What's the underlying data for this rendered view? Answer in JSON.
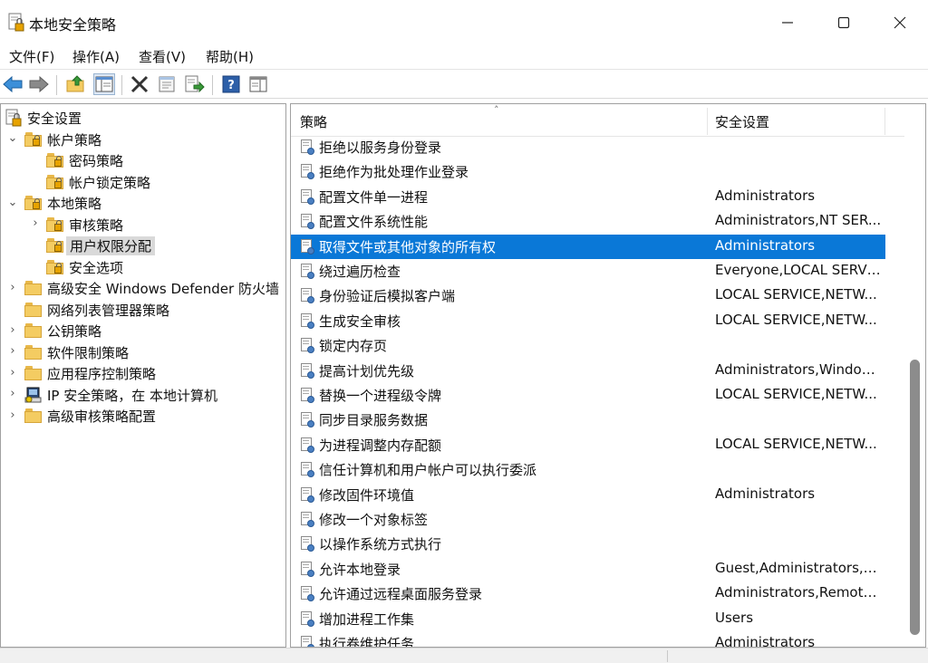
{
  "window": {
    "title": "本地安全策略",
    "minimize_icon": "minimize-icon",
    "maximize_icon": "maximize-icon",
    "close_icon": "close-icon"
  },
  "menu": [
    {
      "label": "文件(F)"
    },
    {
      "label": "操作(A)"
    },
    {
      "label": "查看(V)"
    },
    {
      "label": "帮助(H)"
    }
  ],
  "toolbar": {
    "icons": [
      "back-arrow-icon",
      "forward-arrow-icon",
      "up-folder-icon",
      "show-hide-tree-icon",
      "delete-icon",
      "properties-icon",
      "export-list-icon",
      "help-icon",
      "console-tree-icon"
    ]
  },
  "tree": {
    "items": [
      {
        "label": "安全设置",
        "level": 0,
        "arrow": "",
        "icon": "security-settings-icon"
      },
      {
        "label": "帐户策略",
        "level": 1,
        "arrow": "⌄",
        "icon": "lock-folder-icon"
      },
      {
        "label": "密码策略",
        "level": 2,
        "arrow": "",
        "icon": "lock-folder-icon"
      },
      {
        "label": "帐户锁定策略",
        "level": 2,
        "arrow": "",
        "icon": "lock-folder-icon"
      },
      {
        "label": "本地策略",
        "level": 1,
        "arrow": "⌄",
        "icon": "lock-folder-icon"
      },
      {
        "label": "审核策略",
        "level": 2,
        "arrow": "›",
        "icon": "lock-folder-icon"
      },
      {
        "label": "用户权限分配",
        "level": 2,
        "arrow": "",
        "icon": "lock-folder-icon",
        "selected": true
      },
      {
        "label": "安全选项",
        "level": 2,
        "arrow": "",
        "icon": "lock-folder-icon"
      },
      {
        "label": "高级安全 Windows Defender 防火墙",
        "level": 1,
        "arrow": "›",
        "icon": "folder-icon"
      },
      {
        "label": "网络列表管理器策略",
        "level": 1,
        "arrow": "",
        "icon": "folder-icon"
      },
      {
        "label": "公钥策略",
        "level": 1,
        "arrow": "›",
        "icon": "folder-icon"
      },
      {
        "label": "软件限制策略",
        "level": 1,
        "arrow": "›",
        "icon": "folder-icon"
      },
      {
        "label": "应用程序控制策略",
        "level": 1,
        "arrow": "›",
        "icon": "folder-icon"
      },
      {
        "label": "IP 安全策略，在 本地计算机",
        "level": 1,
        "arrow": "›",
        "icon": "ip-security-icon"
      },
      {
        "label": "高级审核策略配置",
        "level": 1,
        "arrow": "›",
        "icon": "folder-icon"
      }
    ]
  },
  "list": {
    "columns": [
      "策略",
      "安全设置"
    ],
    "sort_indicator": "˄",
    "rows": [
      {
        "policy": "拒绝以服务身份登录",
        "setting": ""
      },
      {
        "policy": "拒绝作为批处理作业登录",
        "setting": ""
      },
      {
        "policy": "配置文件单一进程",
        "setting": "Administrators"
      },
      {
        "policy": "配置文件系统性能",
        "setting": "Administrators,NT SER..."
      },
      {
        "policy": "取得文件或其他对象的所有权",
        "setting": "Administrators",
        "selected": true
      },
      {
        "policy": "绕过遍历检查",
        "setting": "Everyone,LOCAL SERVI..."
      },
      {
        "policy": "身份验证后模拟客户端",
        "setting": "LOCAL SERVICE,NETW..."
      },
      {
        "policy": "生成安全审核",
        "setting": "LOCAL SERVICE,NETW..."
      },
      {
        "policy": "锁定内存页",
        "setting": ""
      },
      {
        "policy": "提高计划优先级",
        "setting": "Administrators,Window ..."
      },
      {
        "policy": "替换一个进程级令牌",
        "setting": "LOCAL SERVICE,NETW..."
      },
      {
        "policy": "同步目录服务数据",
        "setting": ""
      },
      {
        "policy": "为进程调整内存配额",
        "setting": "LOCAL SERVICE,NETW..."
      },
      {
        "policy": "信任计算机和用户帐户可以执行委派",
        "setting": ""
      },
      {
        "policy": "修改固件环境值",
        "setting": "Administrators"
      },
      {
        "policy": "修改一个对象标签",
        "setting": ""
      },
      {
        "policy": "以操作系统方式执行",
        "setting": ""
      },
      {
        "policy": "允许本地登录",
        "setting": "Guest,Administrators,U..."
      },
      {
        "policy": "允许通过远程桌面服务登录",
        "setting": "Administrators,Remote ..."
      },
      {
        "policy": "增加进程工作集",
        "setting": "Users"
      },
      {
        "policy": "执行卷维护任务",
        "setting": "Administrators"
      }
    ]
  },
  "colors": {
    "selection": "#0a78d7",
    "tree_selection": "#d9d9d9"
  }
}
